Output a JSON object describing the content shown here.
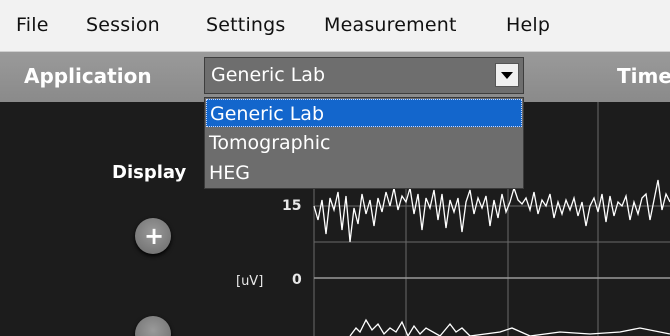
{
  "menu": {
    "items": [
      "File",
      "Session",
      "Settings",
      "Measurement",
      "Help"
    ]
  },
  "app_bar": {
    "application_label": "Application",
    "time_label": "Time"
  },
  "application_select": {
    "value": "Generic Lab",
    "options": [
      "Generic Lab",
      "Tomographic",
      "HEG"
    ],
    "selected_index": 0
  },
  "display": {
    "label": "Display",
    "tick_15": "15",
    "tick_0": "0",
    "unit": "[uV]"
  },
  "colors": {
    "selection_blue": "#1366cc",
    "panel_gray": "#8f8f8f",
    "plot_background": "#1c1c1c"
  }
}
